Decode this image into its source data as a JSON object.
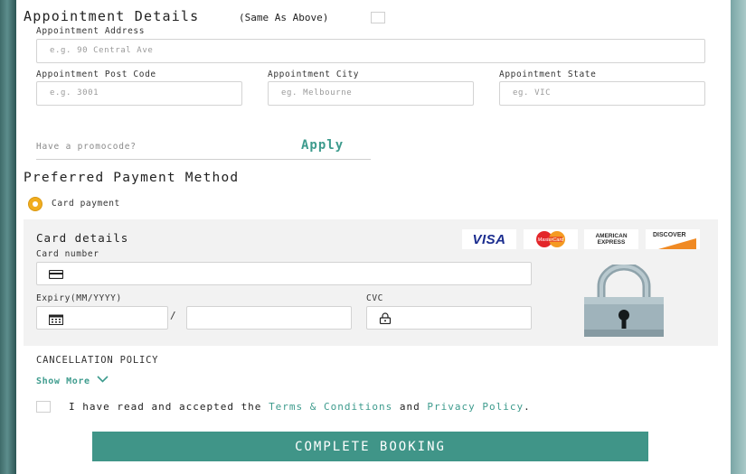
{
  "appointment": {
    "title": "Appointment Details",
    "same_as_above": "(Same As Above)",
    "address_label": "Appointment Address",
    "address_placeholder": "e.g. 90 Central Ave",
    "postcode_label": "Appointment Post Code",
    "postcode_placeholder": "e.g. 3001",
    "city_label": "Appointment City",
    "city_placeholder": "eg. Melbourne",
    "state_label": "Appointment State",
    "state_placeholder": "eg. VIC"
  },
  "promo": {
    "placeholder": "Have a promocode?",
    "apply_label": "Apply"
  },
  "payment": {
    "title": "Preferred Payment Method",
    "method_label": "Card payment",
    "card_title": "Card details",
    "card_number_label": "Card number",
    "expiry_label": "Expiry(MM/YYYY)",
    "expiry_separator": "/",
    "cvc_label": "CVC",
    "logos": {
      "visa": "VISA",
      "mastercard": "MasterCard",
      "amex_line1": "AMERICAN",
      "amex_line2": "EXPRESS",
      "discover": "DISCOVER"
    }
  },
  "policy": {
    "title": "CANCELLATION POLICY",
    "show_more": "Show More"
  },
  "terms": {
    "prefix": "I have read and accepted the",
    "terms_link": "Terms & Conditions",
    "and": "and",
    "privacy_link": "Privacy Policy",
    "suffix": "."
  },
  "submit_label": "COMPLETE BOOKING",
  "colors": {
    "accent": "#409588",
    "link": "#3d9b8d",
    "radio": "#f1ad1f"
  }
}
